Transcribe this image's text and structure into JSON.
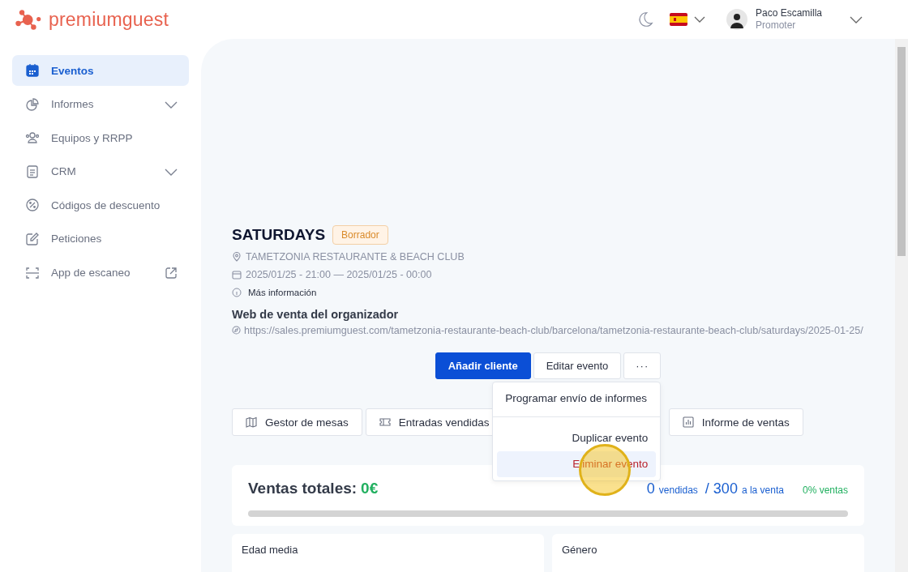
{
  "logo": {
    "text": "premiumguest"
  },
  "header": {
    "user": {
      "name": "Paco Escamilla",
      "role": "Promoter"
    }
  },
  "sidebar": {
    "items": [
      {
        "label": "Eventos",
        "selected": true,
        "expandable": false,
        "external": false
      },
      {
        "label": "Informes",
        "selected": false,
        "expandable": true,
        "external": false
      },
      {
        "label": "Equipos y RRPP",
        "selected": false,
        "expandable": false,
        "external": false
      },
      {
        "label": "CRM",
        "selected": false,
        "expandable": true,
        "external": false
      },
      {
        "label": "Códigos de descuento",
        "selected": false,
        "expandable": false,
        "external": false
      },
      {
        "label": "Peticiones",
        "selected": false,
        "expandable": false,
        "external": false
      },
      {
        "label": "App de escaneo",
        "selected": false,
        "expandable": false,
        "external": true
      }
    ]
  },
  "event": {
    "title": "SATURDAYS",
    "status": "Borrador",
    "venue": "TAMETZONIA RESTAURANTE & BEACH CLUB",
    "dates": "2025/01/25 - 21:00 — 2025/01/25 - 00:00",
    "more_info": "Más información",
    "web_heading": "Web de venta del organizador",
    "web_url": "https://sales.premiumguest.com/tametzonia-restaurante-beach-club/barcelona/tametzonia-restaurante-beach-club/saturdays/2025-01-25/"
  },
  "actions": {
    "primary": "Añadir cliente",
    "secondary": "Editar evento",
    "more": "···"
  },
  "menu": {
    "items": [
      {
        "label": "Programar envío de informes",
        "kind": "normal",
        "selected": false
      },
      {
        "label": "Duplicar evento",
        "kind": "normal",
        "selected": false
      },
      {
        "label": "Eliminar evento",
        "kind": "danger",
        "selected": true
      }
    ]
  },
  "tools": [
    {
      "label": "Gestor de mesas"
    },
    {
      "label": "Entradas vendidas"
    },
    {
      "label": "Informe de ventas"
    }
  ],
  "sales": {
    "label": "Ventas totales:",
    "amount": "0€",
    "sold": "0",
    "sold_label": "vendidas",
    "separator": "/",
    "available": "300",
    "available_label": "a la venta",
    "percent": "0% ventas",
    "level": 0
  },
  "cards": [
    {
      "title": "Edad media"
    },
    {
      "title": "Género"
    }
  ]
}
